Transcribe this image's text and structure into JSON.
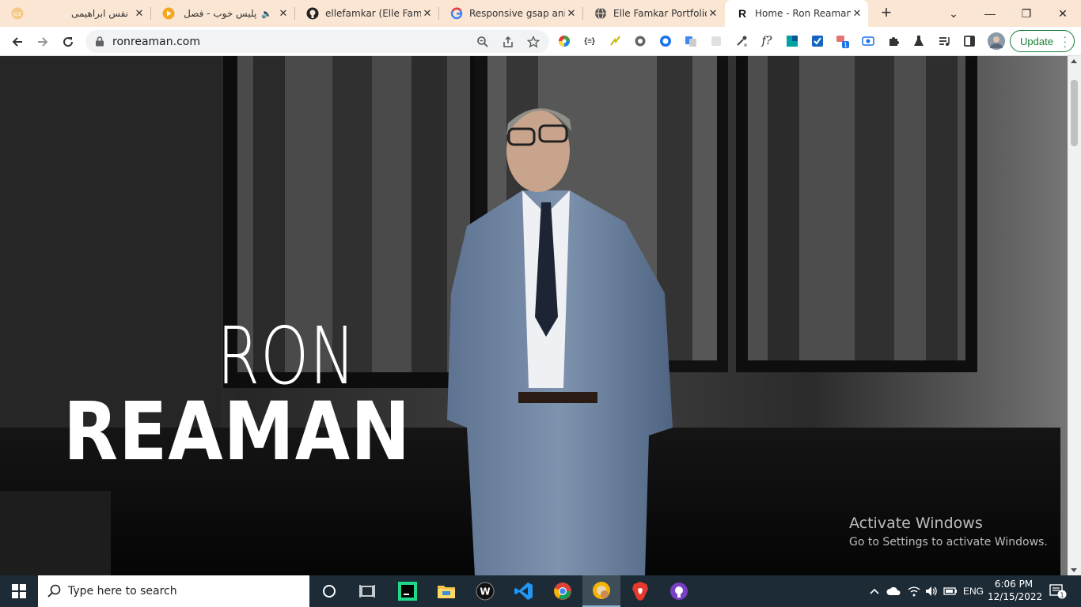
{
  "browser": {
    "tabs": [
      {
        "title": "نفس ابراهیمی",
        "icon": "nafas-logo-icon",
        "rtl": true
      },
      {
        "title": "پلیس خوب - فصل",
        "icon": "play-icon",
        "rtl": true,
        "audio": true
      },
      {
        "title": "ellefamkar (Elle Famkar)",
        "icon": "github-icon",
        "rtl": false
      },
      {
        "title": "Responsive gsap animation",
        "icon": "google-icon",
        "rtl": false
      },
      {
        "title": "Elle Famkar Portfolio |",
        "icon": "globe-icon",
        "rtl": false
      },
      {
        "title": "Home - Ron Reaman |",
        "icon": "r-logo-icon",
        "rtl": false,
        "active": true
      }
    ],
    "close_glyph": "✕",
    "new_tab_glyph": "+",
    "url": "ronreaman.com",
    "update_label": "Update",
    "window_controls": {
      "tablist": "⌄",
      "minimize": "—",
      "maximize": "❐",
      "close": "✕"
    },
    "extension_badge": "1",
    "extension_code_label": "{≡}",
    "extension_fn_label": "f?"
  },
  "hero": {
    "first_name": "RON",
    "last_name": "REAMAN"
  },
  "watermark": {
    "line1": "Activate Windows",
    "line2": "Go to Settings to activate Windows."
  },
  "taskbar": {
    "search_placeholder": "Type here to search",
    "language": "ENG",
    "time": "6:06 PM",
    "date": "12/15/2022",
    "notification_count": "1"
  },
  "colors": {
    "tabstrip_bg": "#fbe6d4",
    "update_green": "#188038",
    "taskbar_bg": "#1c2b36"
  }
}
